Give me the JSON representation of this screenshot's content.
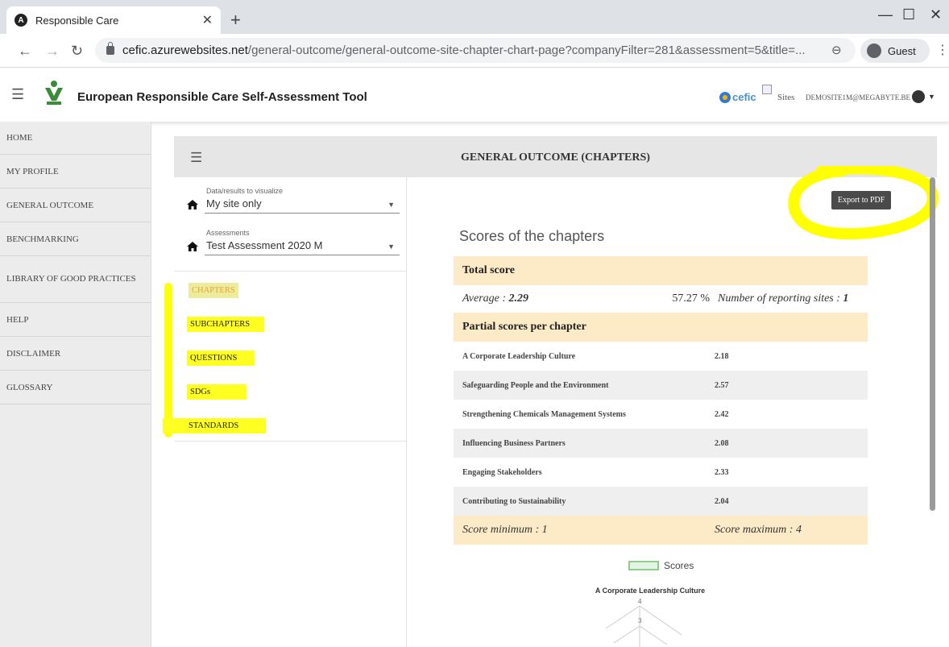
{
  "browser": {
    "tab_title": "Responsible Care",
    "tab_favicon": "A",
    "new_tab": "+",
    "url_host": "cefic.azurewebsites.net",
    "url_path": "/general-outcome/general-outcome-site-chapter-chart-page?companyFilter=281&assessment=5&title=...",
    "profile": "Guest"
  },
  "header": {
    "title": "European Responsible Care Self-Assessment Tool",
    "cefic_label": "cefic",
    "sites_label": "Sites",
    "user_email": "DEMOSITE1M@MEGABYTE.BE"
  },
  "sidebar": {
    "items": [
      {
        "label": "HOME"
      },
      {
        "label": "MY PROFILE"
      },
      {
        "label": "GENERAL OUTCOME"
      },
      {
        "label": "BENCHMARKING"
      },
      {
        "label": "LIBRARY OF GOOD PRACTICES"
      },
      {
        "label": "HELP"
      },
      {
        "label": "DISCLAIMER"
      },
      {
        "label": "GLOSSARY"
      }
    ]
  },
  "page": {
    "title": "GENERAL OUTCOME (CHAPTERS)",
    "filters": {
      "data_label": "Data/results to visualize",
      "data_value": "My site only",
      "assessment_label": "Assessments",
      "assessment_value": "Test Assessment 2020 M"
    },
    "links": [
      "CHAPTERS",
      "SUBCHAPTERS",
      "QUESTIONS",
      "SDGs",
      "STANDARDS"
    ],
    "active_link": "CHAPTERS",
    "export_label": "Export to PDF",
    "scores_title": "Scores of the chapters",
    "total_score_header": "Total score",
    "average_label": "Average : ",
    "average_value": "2.29",
    "percent": "57.27 %",
    "reporting_label": "Number of reporting sites : ",
    "reporting_value": "1",
    "partial_header": "Partial scores per chapter",
    "chapters": [
      {
        "name": "A Corporate Leadership Culture",
        "score": "2.18"
      },
      {
        "name": "Safeguarding People and the Environment",
        "score": "2.57"
      },
      {
        "name": "Strengthening Chemicals Management Systems",
        "score": "2.42"
      },
      {
        "name": "Influencing Business Partners",
        "score": "2.08"
      },
      {
        "name": "Engaging Stakeholders",
        "score": "2.33"
      },
      {
        "name": "Contributing to Sustainability",
        "score": "2.04"
      }
    ],
    "score_min": "Score minimum : 1",
    "score_max": "Score maximum : 4",
    "legend_label": "Scores",
    "radar_top_label": "A Corporate Leadership Culture",
    "radar_tick_4": "4",
    "radar_tick_3": "3"
  },
  "colors": {
    "highlight": "#ffff00",
    "score_header_bg": "#fdebc8",
    "active_link": "#e8a23a"
  }
}
